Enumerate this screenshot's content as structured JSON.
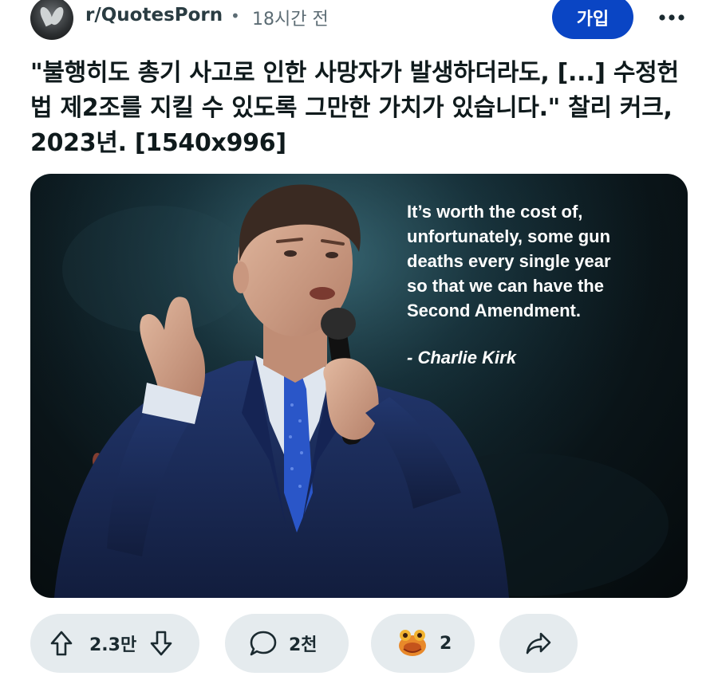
{
  "post": {
    "subreddit": "r/QuotesPorn",
    "separator": "•",
    "time_ago": "18시간 전",
    "join_label": "가입",
    "title": "\"불행히도 총기 사고로 인한 사망자가 발생하더라도, [...] 수정헌법 제2조를 지킬 수 있도록 그만한 가치가 있습니다.\" 찰리 커크, 2023년. [1540x996]"
  },
  "image": {
    "quote": "It’s worth the cost of,\nunfortunately, some gun\ndeaths every single year\nso that we can have the\nSecond Amendment.",
    "author": "- Charlie Kirk"
  },
  "actions": {
    "upvotes": "2.3만",
    "comments": "2천",
    "awards": "2"
  },
  "colors": {
    "join_button": "#0a45c4",
    "action_pill": "#e5ebee",
    "suit": "#1a2c5e",
    "tie": "#2a56c8"
  },
  "icons": [
    "more-options-icon",
    "upvote-icon",
    "downvote-icon",
    "comment-icon",
    "award-icon",
    "share-icon"
  ]
}
